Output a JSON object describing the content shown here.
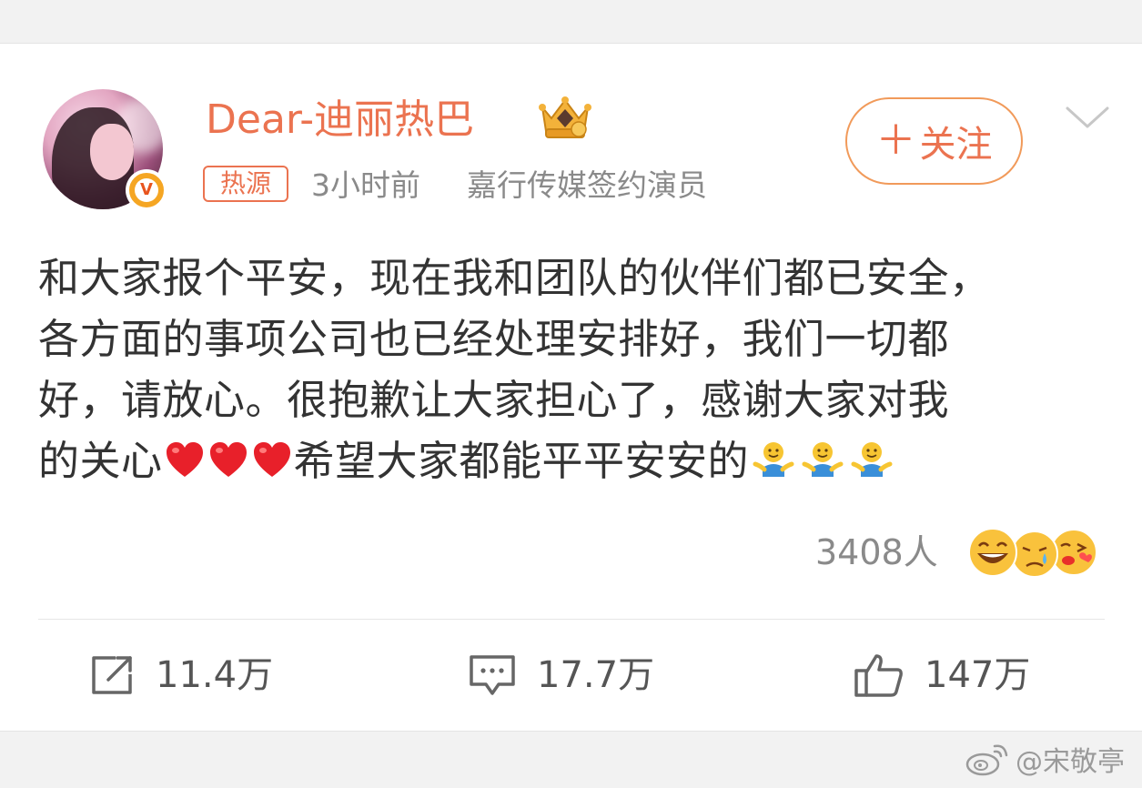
{
  "post": {
    "username": "Dear-迪丽热巴",
    "hot_tag": "热源",
    "time": "3小时前",
    "source": "嘉行传媒签约演员",
    "follow_label": "关注",
    "follow_plus": "＋",
    "text_lines": [
      "和大家报个平安，现在我和团队的伙伴们都已安全，",
      "各方面的事项公司也已经处理安排好，我们一切都",
      "好，请放心。很抱歉让大家担心了，感谢大家对我",
      "的关心",
      "希望大家都能平平安安的"
    ],
    "inline_emoji": {
      "hearts": [
        "heart-emoji",
        "heart-emoji",
        "heart-emoji"
      ],
      "hugs": [
        "hug-emoji",
        "hug-emoji",
        "hug-emoji"
      ]
    },
    "reactions_count": "3408人",
    "reaction_faces": [
      "laughing-face-icon",
      "crying-face-icon",
      "kiss-face-icon"
    ]
  },
  "actions": {
    "repost_count": "11.4万",
    "comment_count": "17.7万",
    "like_count": "147万"
  },
  "watermark": {
    "text": "@宋敬亭",
    "icon": "weibo-logo-icon"
  },
  "colors": {
    "accent": "#eb7350",
    "text": "#333333",
    "muted": "#8a8a8a",
    "heart": "#e8202a",
    "verified": "#f5a623"
  }
}
